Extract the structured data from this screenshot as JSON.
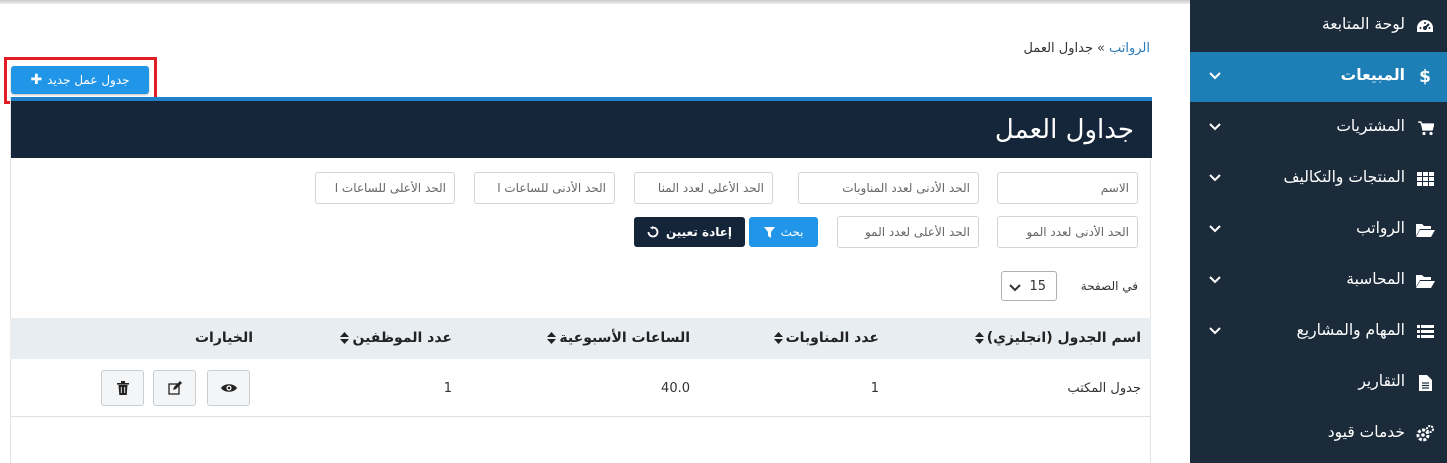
{
  "sidebar": {
    "items": [
      {
        "label": "لوحة المتابعة",
        "icon": "dashboard-icon"
      },
      {
        "label": "المبيعات",
        "icon": "dollar-icon"
      },
      {
        "label": "المشتريات",
        "icon": "cart-icon"
      },
      {
        "label": "المنتجات والتكاليف",
        "icon": "grid-icon"
      },
      {
        "label": "الرواتب",
        "icon": "folder-open-icon"
      },
      {
        "label": "المحاسبة",
        "icon": "folder-open-icon"
      },
      {
        "label": "المهام والمشاريع",
        "icon": "list-icon"
      },
      {
        "label": "التقارير",
        "icon": "document-icon"
      },
      {
        "label": "خدمات قيود",
        "icon": "cogs-icon"
      }
    ],
    "active_item": "المبيعات",
    "active_color": "#1d7fb6",
    "background": "#1b2b3a"
  },
  "breadcrumb": {
    "parent": "الرواتب",
    "separator": "»",
    "current": "جداول العمل"
  },
  "new_button": {
    "label": "جدول عمل جديد",
    "icon": "plus-icon",
    "color": "#2196e8"
  },
  "panel": {
    "title": "جداول العمل",
    "header_color": "#15263a"
  },
  "filters": {
    "name": "الاسم",
    "min_shifts": "الحد الأدنى لعدد المناوبات",
    "max_shifts": "الحد الأعلى لعدد المنا",
    "min_hours": "الحد الأدنى للساعات ا",
    "max_hours": "الحد الأعلى للساعات ا",
    "min_employees": "الحد الأدنى لعدد المو",
    "max_employees": "الحد الأعلى لعدد المو",
    "search_label": "بحث",
    "reset_label": "إعادة تعيين"
  },
  "pagination": {
    "per_page_label": "في الصفحة",
    "per_page_value": "15"
  },
  "table": {
    "columns": [
      "اسم الجدول (انجليزي)",
      "عدد المناوبات",
      "الساعات الأسبوعية",
      "عدد الموظفين",
      "الخيارات"
    ],
    "rows": [
      {
        "name": "جدول المكتب",
        "shifts": "1",
        "weekly_hours": "40.0",
        "employees": "1"
      }
    ]
  }
}
